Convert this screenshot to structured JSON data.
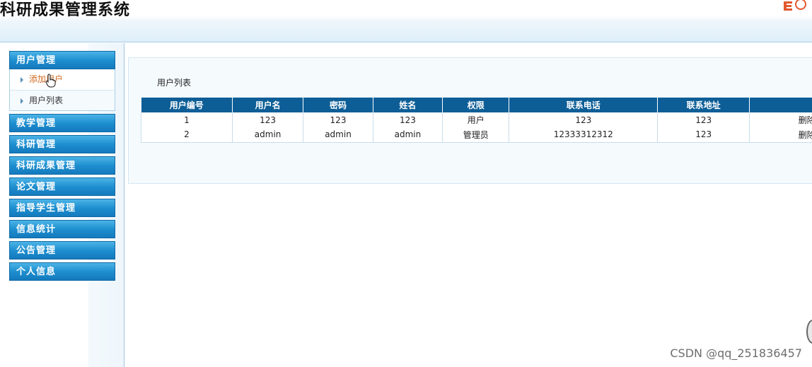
{
  "app": {
    "title": "科研成果管理系统"
  },
  "sidebar": {
    "groups": [
      {
        "label": "用户管理",
        "items": [
          {
            "label": "添加用户",
            "active": true
          },
          {
            "label": "用户列表",
            "active": false
          }
        ]
      },
      {
        "label": "教学管理"
      },
      {
        "label": "科研管理"
      },
      {
        "label": "科研成果管理"
      },
      {
        "label": "论文管理"
      },
      {
        "label": "指导学生管理"
      },
      {
        "label": "信息统计"
      },
      {
        "label": "公告管理"
      },
      {
        "label": "个人信息"
      }
    ]
  },
  "main": {
    "list_title": "用户列表",
    "table": {
      "headers": [
        "用户编号",
        "用户名",
        "密码",
        "姓名",
        "权限",
        "联系电话",
        "联系地址",
        ""
      ],
      "rows": [
        [
          "1",
          "123",
          "123",
          "123",
          "用户",
          "123",
          "123",
          "删除"
        ],
        [
          "2",
          "admin",
          "admin",
          "admin",
          "管理员",
          "12333312312",
          "123",
          "删除"
        ]
      ]
    }
  },
  "watermark": "CSDN @qq_251836457",
  "colors": {
    "menu_blue": "#1e8fd0",
    "table_header": "#0d5e97",
    "active_link": "#d2691e"
  }
}
